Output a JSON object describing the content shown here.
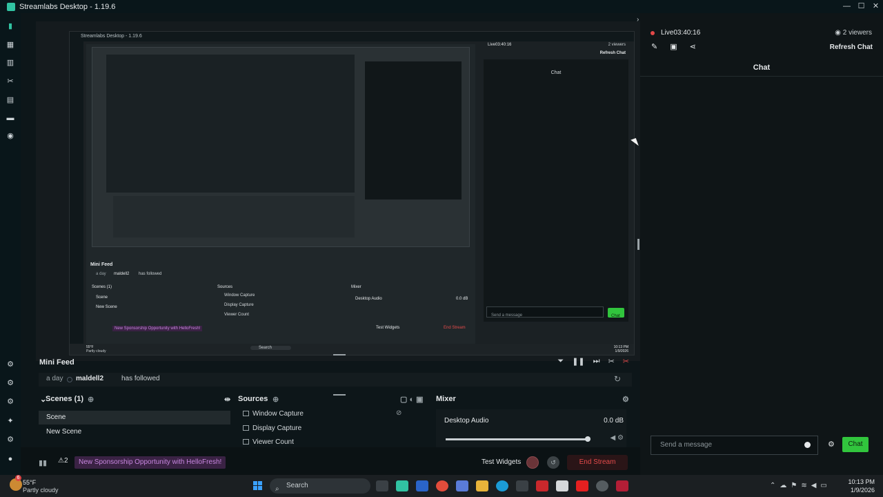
{
  "window": {
    "title": "Streamlabs Desktop - 1.19.6",
    "controls": [
      "—",
      "☐",
      "✕"
    ]
  },
  "nested_preview": {
    "title": "Streamlabs Desktop - 1.19.6",
    "live_time": "Live03:40:16",
    "viewers": "2 viewers",
    "refresh": "Refresh Chat",
    "chat_header": "Chat",
    "message_placeholder": "Send a message",
    "chat_button": "Chat",
    "mini_feed": "Mini Feed",
    "feed_time": "a day",
    "feed_user": "maldell2",
    "feed_action": "has followed",
    "scenes": "Scenes (1)",
    "scene_items": [
      "Scene",
      "New Scene"
    ],
    "sources": "Sources",
    "source_items": [
      "Window Capture",
      "Display Capture",
      "Viewer Count"
    ],
    "mixer": "Mixer",
    "mixer_item": "Desktop Audio",
    "mixer_db": "0.0 dB",
    "promo": "New Sponsorship Opportunity with HelloFresh!",
    "test_widgets": "Test Widgets",
    "end_stream": "End Stream",
    "search": "Search",
    "temp": "55°F",
    "weather": "Partly cloudy",
    "clock": "10:13 PM",
    "date": "1/9/2026"
  },
  "mini_feed": {
    "title": "Mini Feed",
    "event": {
      "time": "a day",
      "user": "maldell2",
      "action": "has followed"
    }
  },
  "scenes": {
    "title": "Scenes (1)",
    "items": [
      "Scene",
      "New Scene"
    ]
  },
  "sources": {
    "title": "Sources",
    "items": [
      "Window Capture",
      "Display Capture",
      "Viewer Count"
    ]
  },
  "mixer": {
    "title": "Mixer",
    "items": [
      {
        "name": "Desktop Audio",
        "db": "0.0 dB",
        "level": 0.98
      }
    ]
  },
  "bottom_bar": {
    "alert_count": "2",
    "promo": "New Sponsorship Opportunity with HelloFresh!",
    "test_widgets": "Test Widgets",
    "end_stream": "End Stream"
  },
  "chat": {
    "live_time": "Live03:40:16",
    "viewers": "2 viewers",
    "refresh": "Refresh Chat",
    "header": "Chat",
    "placeholder": "Send a message",
    "send_label": "Chat"
  },
  "taskbar": {
    "temp": "55°F",
    "weather": "Partly cloudy",
    "search": "Search",
    "time": "10:13 PM",
    "date": "1/9/2026",
    "badge": "6"
  },
  "colors": {
    "accent_green": "#31c53d",
    "live_red": "#e24848",
    "brand_teal": "#31c3a2",
    "promo_purple": "#c887e0"
  }
}
